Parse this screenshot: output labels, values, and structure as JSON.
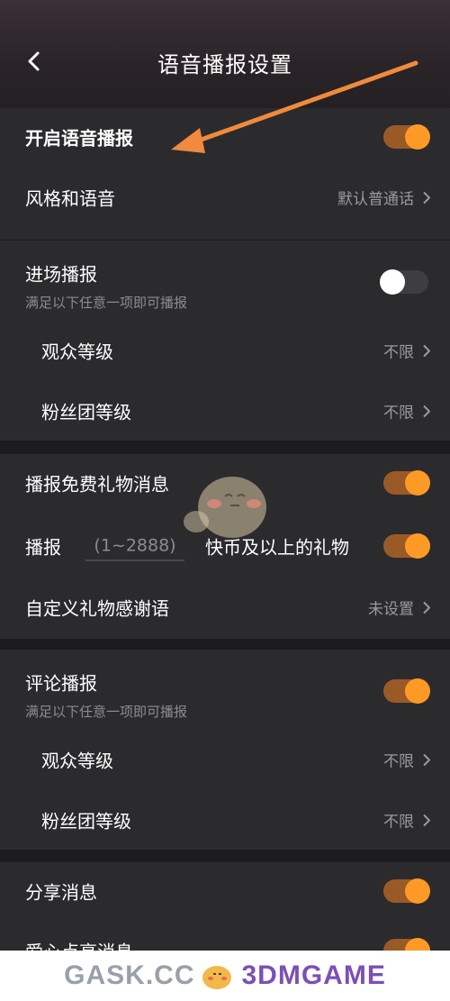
{
  "header": {
    "title": "语音播报设置",
    "back_icon": "chevron-left-icon"
  },
  "accent_color": "#ff9a26",
  "section1": {
    "enable_voice": {
      "label": "开启语音播报",
      "toggle_on": true
    },
    "style_voice": {
      "label": "风格和语音",
      "value": "默认普通话"
    }
  },
  "section2": {
    "entry": {
      "label": "进场播报",
      "hint": "满足以下任意一项即可播报",
      "toggle_on": false
    },
    "audience_level": {
      "label": "观众等级",
      "value": "不限"
    },
    "fan_level": {
      "label": "粉丝团等级",
      "value": "不限"
    }
  },
  "section3": {
    "free_gift": {
      "label": "播报免费礼物消息",
      "toggle_on": true
    },
    "gift_threshold": {
      "prefix": "播报",
      "placeholder": "(1~2888)",
      "suffix": "快币及以上的礼物",
      "toggle_on": true
    },
    "thanks": {
      "label": "自定义礼物感谢语",
      "value": "未设置"
    }
  },
  "section4": {
    "comment": {
      "label": "评论播报",
      "hint": "满足以下任意一项即可播报",
      "toggle_on": true
    },
    "audience_level": {
      "label": "观众等级",
      "value": "不限"
    },
    "fan_level": {
      "label": "粉丝团等级",
      "value": "不限"
    }
  },
  "section5": {
    "share": {
      "label": "分享消息",
      "toggle_on": true
    },
    "like": {
      "label": "爱心点亮消息",
      "toggle_on": true
    }
  },
  "footer": {
    "brand_left": "GASK.CC",
    "brand_right": "3DMGAME"
  }
}
